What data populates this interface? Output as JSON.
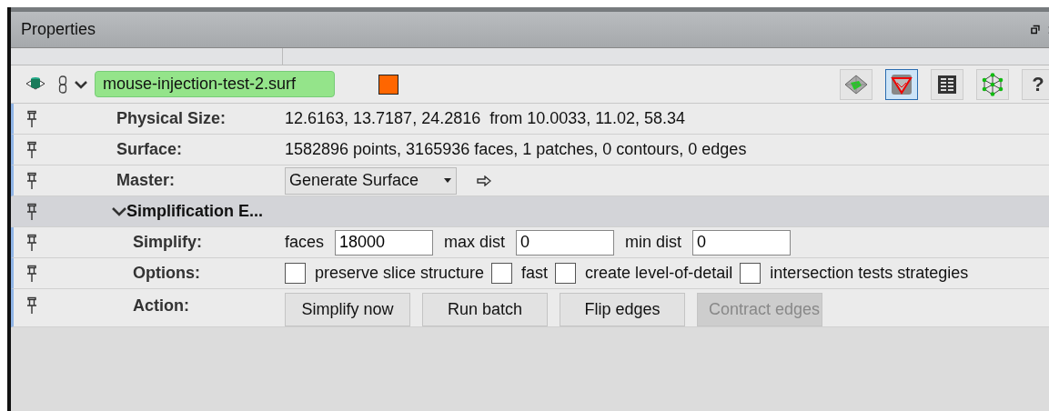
{
  "panel": {
    "title": "Properties"
  },
  "toolbar": {
    "file_name": "mouse-injection-test-2.surf",
    "color": "#ff6600",
    "tools": [
      {
        "kind": "mesh",
        "selected": false
      },
      {
        "kind": "triangle",
        "selected": true
      },
      {
        "kind": "list",
        "selected": false
      },
      {
        "kind": "network",
        "selected": false
      },
      {
        "kind": "help",
        "label": "?",
        "selected": false
      }
    ]
  },
  "rows": [
    {
      "kind": "text",
      "label": "Physical Size:",
      "value": "12.6163, 13.7187, 24.2816  from 10.0033, 11.02, 58.34"
    },
    {
      "kind": "text",
      "label": "Surface:",
      "value": "1582896 points, 3165936 faces, 1 patches, 0 contours, 0 edges"
    },
    {
      "kind": "dropdown",
      "label": "Master:",
      "value": "Generate Surface"
    },
    {
      "kind": "section",
      "label": "Simplification E...",
      "expanded": true,
      "children": [
        {
          "kind": "fields",
          "label": "Simplify:",
          "fields": [
            {
              "label": "faces",
              "value": "18000"
            },
            {
              "label": "max dist",
              "value": "0"
            },
            {
              "label": "min dist",
              "value": "0"
            }
          ]
        },
        {
          "kind": "checks",
          "label": "Options:",
          "options": [
            {
              "label": "preserve slice structure",
              "checked": false
            },
            {
              "label": "fast",
              "checked": false
            },
            {
              "label": "create level-of-detail",
              "checked": false
            },
            {
              "label": "intersection tests strategies",
              "checked": false
            }
          ]
        },
        {
          "kind": "buttons",
          "label": "Action:",
          "buttons": [
            {
              "label": "Simplify now",
              "disabled": false
            },
            {
              "label": "Run batch",
              "disabled": false
            },
            {
              "label": "Flip edges",
              "disabled": false
            },
            {
              "label": "Contract edges",
              "disabled": true
            }
          ]
        }
      ]
    }
  ]
}
